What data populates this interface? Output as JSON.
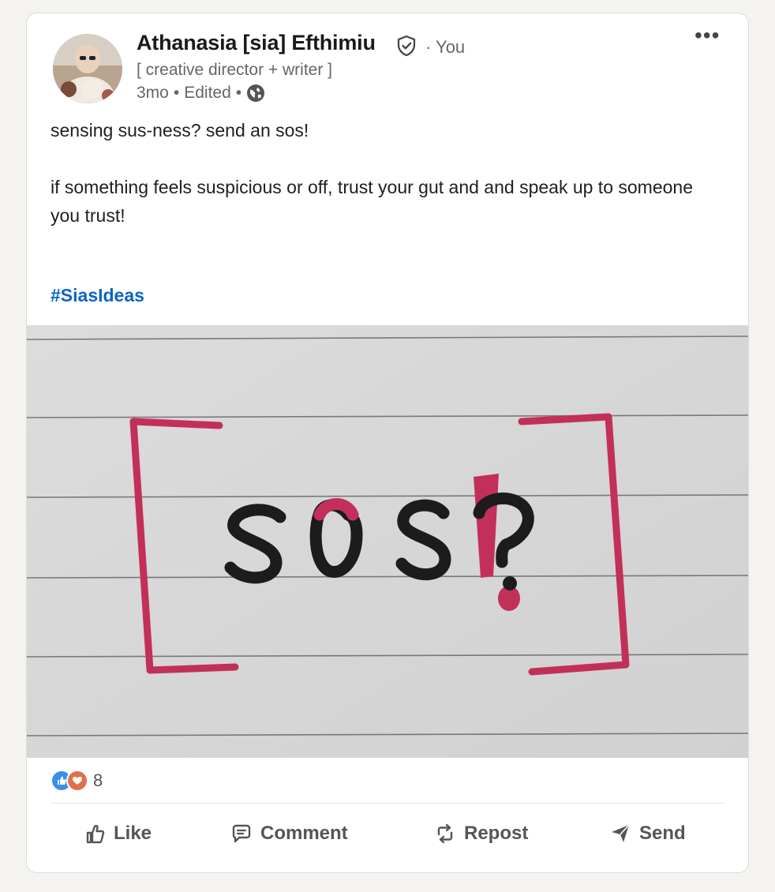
{
  "author": {
    "name": "Athanasia [sia] Efthimiu",
    "relation": "· You",
    "headline": "[ creative director + writer ]",
    "time": "3mo",
    "edited": "Edited",
    "separator": "•"
  },
  "post": {
    "line1": "sensing sus-ness? send an sos!",
    "line2": "if something feels suspicious or off, trust your gut and and speak up to someone you trust!",
    "hashtag": "#SiasIdeas",
    "image_text": "SOS?!"
  },
  "reactions": {
    "count": "8",
    "types": [
      "like-icon",
      "love-icon"
    ]
  },
  "actions": {
    "like": "Like",
    "comment": "Comment",
    "repost": "Repost",
    "send": "Send"
  },
  "colors": {
    "accent": "#0a66c2",
    "bracket": "#c2305a",
    "ink": "#1c1c1c"
  }
}
